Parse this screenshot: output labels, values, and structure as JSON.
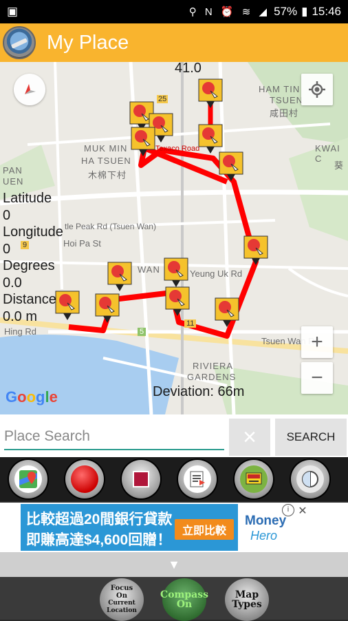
{
  "status_bar": {
    "battery": "57%",
    "time": "15:46",
    "icons": "⚲ N ⏰ ≋ ◢"
  },
  "app_bar": {
    "title": "My Place"
  },
  "map": {
    "speed": "41.0",
    "info": {
      "latitude_label": "Latitude",
      "latitude_value": "0",
      "longitude_label": "Longitude",
      "longitude_value": "0",
      "degrees_label": "Degrees",
      "degrees_value": "0.0",
      "distance_label": "Distance",
      "distance_value": "0.0 m"
    },
    "deviation": "Deviation: 66m",
    "google": "Google",
    "labels": {
      "ham_tin": "HAM TIN",
      "tsuen": "TSUEN",
      "tsuen_cn": "咸田村",
      "muk_min": "MUK MIN",
      "ha_tsuen": "HA TSUEN",
      "muk_cn": "木棉下村",
      "kwai": "KWAI C",
      "kwai_cn": "葵",
      "pan": "PAN",
      "uen": "UEN",
      "castle_peak": "tle Peak Rd (Tsuen Wan)",
      "hoi_pa": "Hoi Pa St",
      "wan": "WAN",
      "yeung_uk": "Yeung Uk Rd",
      "hing_rd": "Hing Rd",
      "tsuen_wan_rd": "Tsuen Wan Rd",
      "riviera": "RIVIERA",
      "gardens": "GARDENS",
      "texaco": "Texaco Road",
      "route_25": "25",
      "route_9": "9",
      "route_5": "5",
      "route_11": "11"
    },
    "zoom_in": "+",
    "zoom_out": "−"
  },
  "search": {
    "placeholder": "Place Search",
    "clear": "×",
    "button": "SEARCH"
  },
  "toolbar": {
    "items": [
      "maps",
      "record",
      "stop",
      "document",
      "website",
      "compass-split"
    ]
  },
  "ad": {
    "line1": "比較超過20間銀行貸款",
    "line2": "即賺高達$4,600回贈！",
    "cta": "立即比較",
    "logo1": "Money",
    "logo2": "Hero",
    "info": "i",
    "close": "✕"
  },
  "collapse": "▼",
  "bottom_bar": {
    "btn1_line1": "Focus",
    "btn1_line2": "On",
    "btn1_line3": "Current Location",
    "btn2_line1": "Compass",
    "btn2_line2": "On",
    "btn3_line1": "Map",
    "btn3_line2": "Types"
  },
  "colors": {
    "app_bar": "#f9b42e",
    "route": "#ff0000",
    "accent": "#2a9b8e",
    "ad_blue": "#2b97d6",
    "ad_orange": "#f28b1c"
  }
}
